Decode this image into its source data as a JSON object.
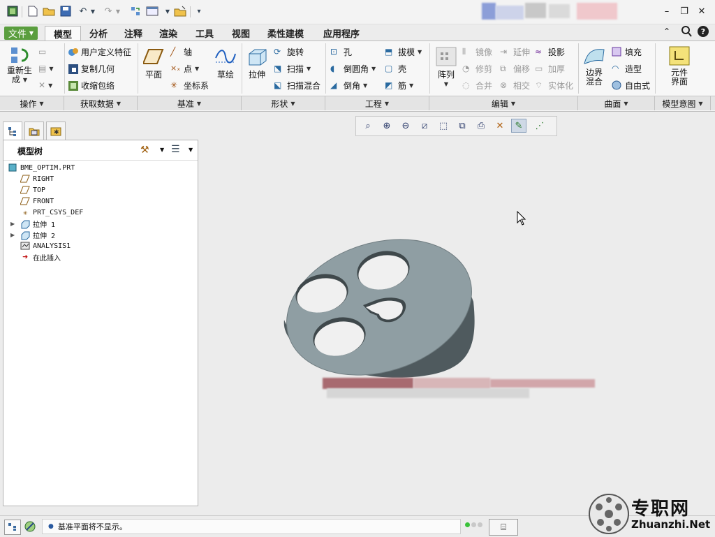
{
  "quick_access": {
    "icons": [
      "app-icon",
      "new-icon",
      "open-icon",
      "save-icon",
      "undo-icon",
      "redo-icon",
      "regenerate-icon",
      "windows-icon",
      "close-window-icon",
      "customize-icon"
    ]
  },
  "tabs": [
    {
      "label": "文件",
      "active": false
    },
    {
      "label": "模型",
      "active": true
    },
    {
      "label": "分析",
      "active": false
    },
    {
      "label": "注释",
      "active": false
    },
    {
      "label": "渲染",
      "active": false
    },
    {
      "label": "工具",
      "active": false
    },
    {
      "label": "视图",
      "active": false
    },
    {
      "label": "柔性建模",
      "active": false
    },
    {
      "label": "应用程序",
      "active": false
    }
  ],
  "ribbon": {
    "operations": {
      "regenerate_line1": "重新生",
      "regenerate_line2": "成"
    },
    "get_data": {
      "udf": "用户定义特征",
      "copy_geom": "复制几何",
      "shrinkwrap": "收缩包络"
    },
    "datum": {
      "plane": "平面",
      "axis": "轴",
      "point": "点",
      "csys": "坐标系",
      "sketch": "草绘"
    },
    "shapes": {
      "extrude": "拉伸",
      "revolve": "旋转",
      "sweep": "扫描",
      "swept_blend": "扫描混合"
    },
    "engineering": {
      "hole": "孔",
      "round": "倒圆角",
      "chamfer": "倒角",
      "draft": "拔模",
      "shell": "壳",
      "rib": "筋"
    },
    "editing": {
      "pattern": "阵列",
      "mirror": "镜像",
      "trim": "修剪",
      "merge": "合并",
      "extend": "延伸",
      "offset": "偏移",
      "intersect": "相交",
      "project": "投影",
      "thicken": "加厚",
      "solidify": "实体化"
    },
    "surfaces": {
      "boundary_line1": "边界",
      "boundary_line2": "混合",
      "fill": "填充",
      "style": "造型",
      "freestyle": "自由式"
    },
    "model_intent": {
      "component_line1": "元件",
      "component_line2": "界面"
    }
  },
  "groups": [
    "操作",
    "获取数据",
    "基准",
    "形状",
    "工程",
    "编辑",
    "曲面",
    "模型意图"
  ],
  "model_tree": {
    "title": "模型树",
    "items": [
      {
        "label": "BME_OPTIM.PRT",
        "icon": "part-icon"
      },
      {
        "label": "RIGHT",
        "icon": "datum-plane-icon"
      },
      {
        "label": "TOP",
        "icon": "datum-plane-icon"
      },
      {
        "label": "FRONT",
        "icon": "datum-plane-icon"
      },
      {
        "label": "PRT_CSYS_DEF",
        "icon": "csys-icon"
      },
      {
        "label": "拉伸 1",
        "icon": "extrude-feature-icon"
      },
      {
        "label": "拉伸 2",
        "icon": "extrude-feature-icon"
      },
      {
        "label": "ANALYSIS1",
        "icon": "analysis-icon"
      },
      {
        "label": "在此插入",
        "icon": "insert-here-arrow-icon"
      }
    ]
  },
  "status": {
    "message": "基准平面将不显示。"
  },
  "watermark": {
    "cn": "专职网",
    "en": "Zhuanzhi.Net"
  },
  "colors": {
    "file_tab": "#5a9e3e",
    "model_body": "#8f9ea3",
    "model_side": "#4f5a5e",
    "background": "#ececec"
  }
}
